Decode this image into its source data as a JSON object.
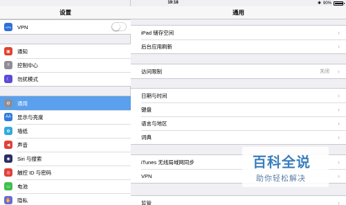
{
  "status_bar": {
    "device": "iPad",
    "time": "19:18",
    "battery_text": "90%",
    "battery_level": 0.9
  },
  "sidebar": {
    "title": "设置",
    "vpn": {
      "label": "VPN",
      "icon": "vpn-icon",
      "color": "#2f6fd6",
      "toggle_on": false
    },
    "group1": [
      {
        "label": "通知",
        "icon": "notification-icon",
        "color": "#e0412f"
      },
      {
        "label": "控制中心",
        "icon": "control-center-icon",
        "color": "#8e8e93"
      },
      {
        "label": "勿扰模式",
        "icon": "moon-icon",
        "color": "#5b4bd6"
      }
    ],
    "group2": [
      {
        "label": "通用",
        "icon": "gear-icon",
        "color": "#8e8e93",
        "active": true
      },
      {
        "label": "显示与亮度",
        "icon": "display-icon",
        "color": "#2f7bde"
      },
      {
        "label": "墙纸",
        "icon": "wallpaper-icon",
        "color": "#34aadc"
      },
      {
        "label": "声音",
        "icon": "sound-icon",
        "color": "#e0413a"
      },
      {
        "label": "Siri 与搜索",
        "icon": "siri-icon",
        "color": "#2b2d66"
      },
      {
        "label": "触控 ID 与密码",
        "icon": "fingerprint-icon",
        "color": "#e0413a"
      },
      {
        "label": "电池",
        "icon": "battery-icon",
        "color": "#3fbf4f"
      },
      {
        "label": "隐私",
        "icon": "hand-icon",
        "color": "#6b6bd6"
      }
    ]
  },
  "main": {
    "title": "通用",
    "group1": [
      {
        "label": "iPad 储存空间"
      },
      {
        "label": "后台应用刷新"
      }
    ],
    "group2": [
      {
        "label": "访问限制",
        "value": "关闭"
      }
    ],
    "group3": [
      {
        "label": "日期与时间"
      },
      {
        "label": "键盘"
      },
      {
        "label": "语言与地区"
      },
      {
        "label": "词典"
      }
    ],
    "group4": [
      {
        "label": "iTunes 无线局域网同步"
      },
      {
        "label": "VPN"
      }
    ],
    "group5": [
      {
        "label": "监管"
      }
    ]
  },
  "watermark": {
    "line1": "百科全说",
    "line2": "助你轻松解决"
  }
}
